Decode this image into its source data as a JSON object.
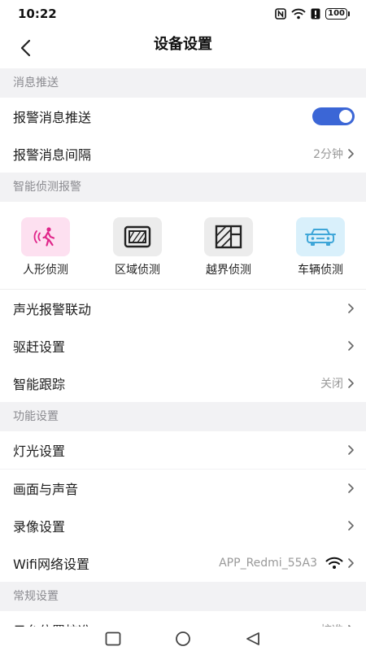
{
  "status_bar": {
    "time": "10:22",
    "battery": "100"
  },
  "header": {
    "title": "设备设置"
  },
  "sections": {
    "message": "消息推送",
    "smart": "智能侦测报警",
    "function": "功能设置",
    "general": "常规设置"
  },
  "message_push": {
    "alarm_push_label": "报警消息推送",
    "alarm_push_on": true,
    "alarm_interval_label": "报警消息间隔",
    "alarm_interval_value": "2分钟"
  },
  "detection": [
    {
      "label": "人形侦测",
      "icon": "human-detection-icon"
    },
    {
      "label": "区域侦测",
      "icon": "area-detection-icon"
    },
    {
      "label": "越界侦测",
      "icon": "line-crossing-icon"
    },
    {
      "label": "车辆侦测",
      "icon": "vehicle-detection-icon"
    }
  ],
  "smart_rows": {
    "light_sound_link": "声光报警联动",
    "deter": "驱赶设置",
    "tracking_label": "智能跟踪",
    "tracking_value": "关闭"
  },
  "function_rows": {
    "light": "灯光设置",
    "picture_sound": "画面与声音",
    "recording": "录像设置",
    "wifi_label": "Wifi网络设置",
    "wifi_value": "APP_Redmi_55A3"
  },
  "general_rows": {
    "ptz_label": "云台位置校准",
    "ptz_value": "校准"
  },
  "colors": {
    "accent": "#3b66d6",
    "human_bg": "#fde0f0",
    "human_fg": "#e0268a",
    "gray_bg": "#ececec",
    "vehicle_bg": "#d9f0fb",
    "vehicle_fg": "#3ea6d8"
  }
}
